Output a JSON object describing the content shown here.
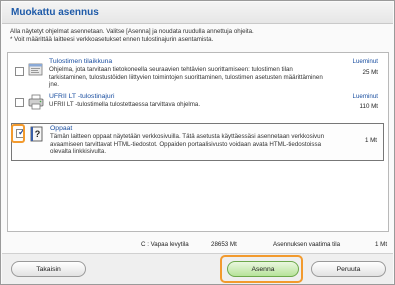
{
  "window": {
    "title": "Muokattu asennus",
    "instructions": [
      "Alla näytetyt ohjelmat asennetaan. Valitse [Asenna] ja noudata ruudulla annettuja ohjeita.",
      "* Voit määrittää laitteesi verkkoasetukset ennen tulostinajurin asentamista."
    ]
  },
  "items": [
    {
      "name": "Tulostimen tilaikkuna",
      "description": "Ohjelma, jota tarvitaan tietokoneella seuraavien tehtävien suorittamiseen: tulostimen tilan tarkistaminen, tulostustöiden liittyvien toimintojen suorittaminen, tulostimen asetusten määrittäminen jne.",
      "readme": "Lueminut",
      "size": "25 Mt",
      "checked": false,
      "icon": "status-window-icon"
    },
    {
      "name": "UFRII LT -tulostinajuri",
      "description": "UFRII LT -tulostimella tulostettaessa tarvittava ohjelma.",
      "readme": "Lueminut",
      "size": "110 Mt",
      "checked": false,
      "icon": "printer-driver-icon"
    },
    {
      "name": "Oppaat",
      "description": "Tämän laitteen oppaat näytetään verkkosivuilla. Tätä asetusta käyttäessäsi asennetaan verkkosivun avaamiseen tarvittavat HTML-tiedostot. Oppaiden portaalisivusto voidaan avata HTML-tiedostoissa olevalta linkkisivulta.",
      "readme": "",
      "size": "1 Mt",
      "checked": true,
      "icon": "manual-help-icon"
    }
  ],
  "footer": {
    "drive_label": "C : Vapaa levytila",
    "drive_free": "28653 Mt",
    "required_label": "Asennuksen vaatima tila",
    "required_value": "1 Mt"
  },
  "buttons": {
    "back": "Takaisin",
    "install": "Asenna",
    "cancel": "Peruuta"
  },
  "colors": {
    "title": "#1e5aa8",
    "highlight": "#f29a2e",
    "install_button": "#b7e39a"
  }
}
